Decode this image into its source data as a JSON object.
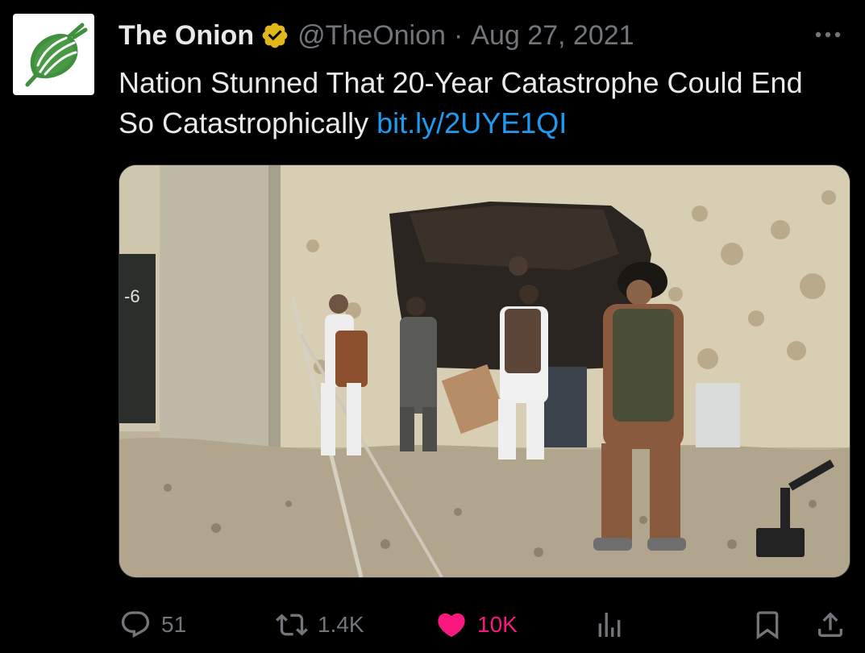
{
  "tweet": {
    "author_name": "The Onion",
    "handle": "@TheOnion",
    "separator": "·",
    "date": "Aug 27, 2021",
    "text": "Nation Stunned That 20-Year Catastrophe Could End So Catastrophically ",
    "link_text": "bit.ly/2UYE1QI",
    "verified_icon": "verified-badge-icon",
    "more_icon": "more-icon"
  },
  "media": {
    "wall_sign_text": "-6"
  },
  "actions": {
    "replies": "51",
    "retweets": "1.4K",
    "likes": "10K",
    "colors": {
      "muted": "#71767b",
      "like": "#f91880",
      "link": "#1d9bf0"
    }
  }
}
